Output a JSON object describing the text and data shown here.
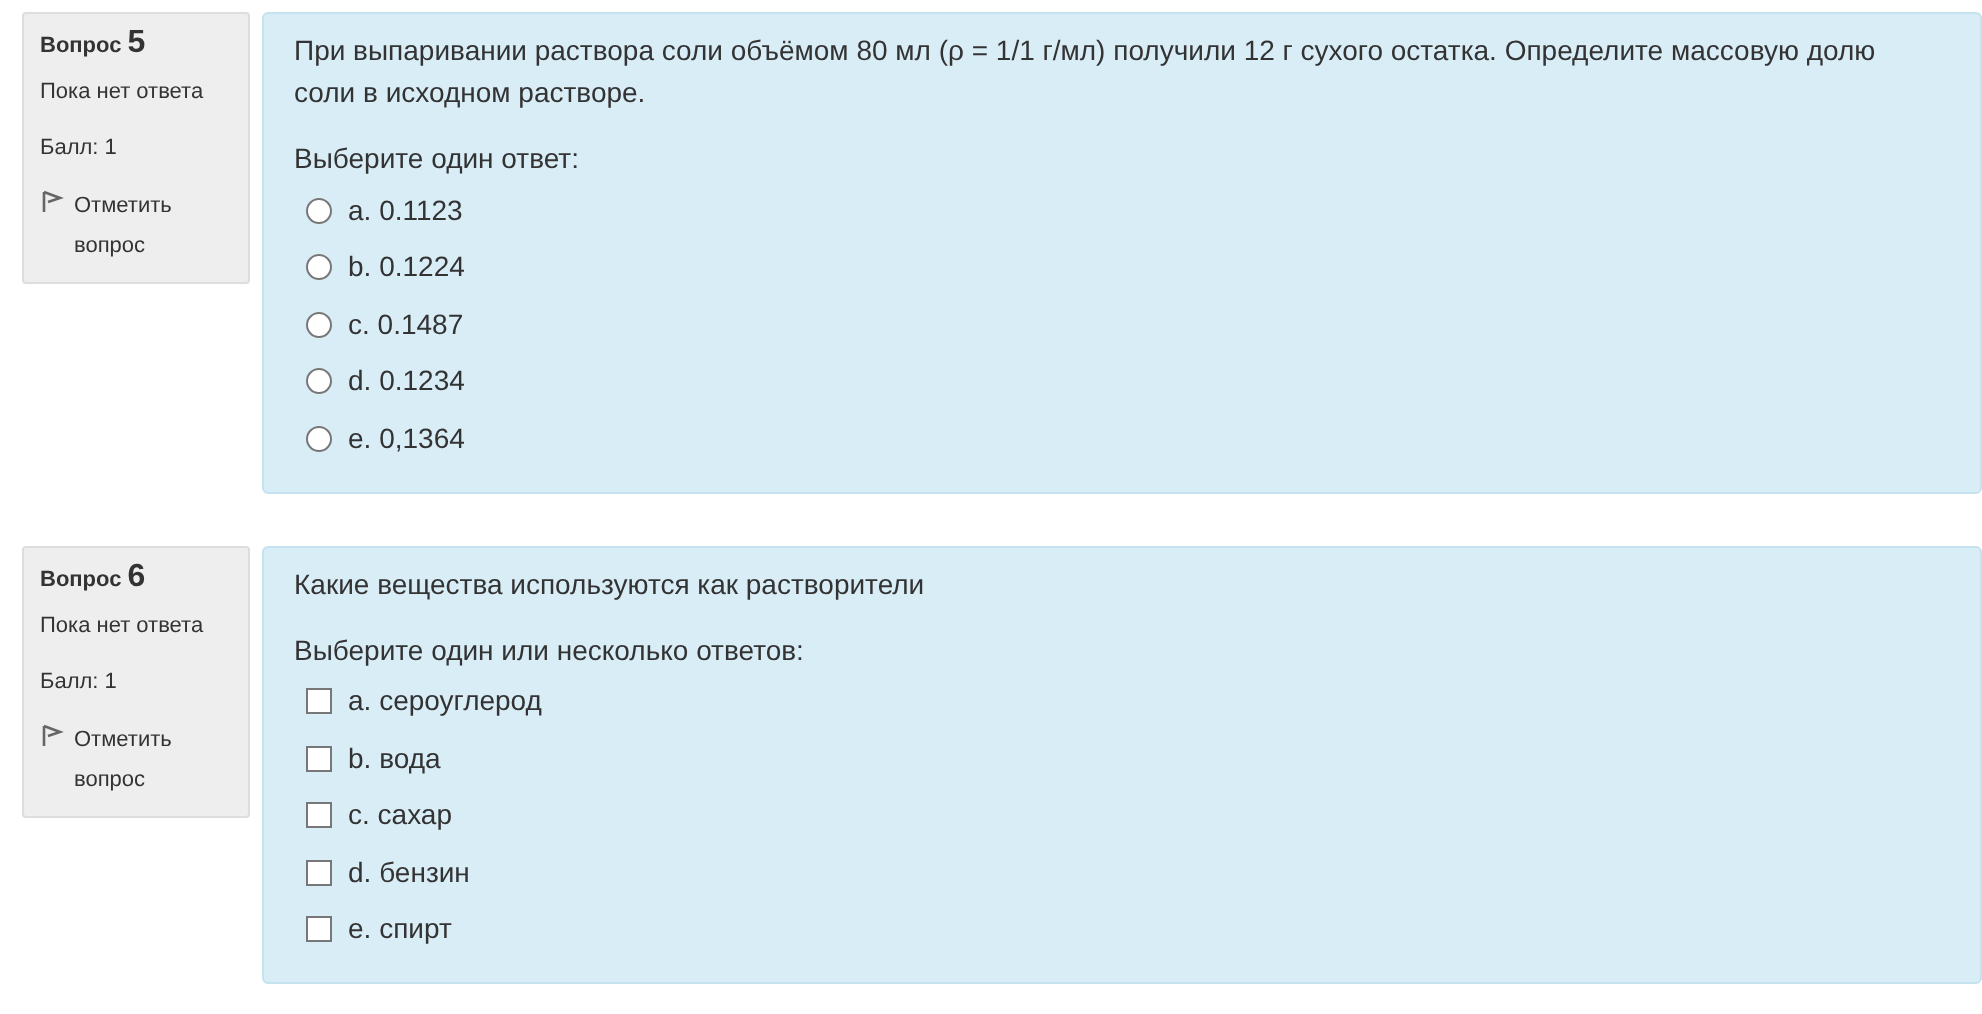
{
  "questions": [
    {
      "label": "Вопрос",
      "number": "5",
      "status": "Пока нет ответа",
      "grade": "Балл: 1",
      "flag": "Отметить вопрос",
      "text": "При выпаривании раствора соли объёмом 80 мл (ρ = 1/1 г/мл) получили 12 г сухого остатка. Определите массовую долю соли в исходном растворе.",
      "prompt": "Выберите один ответ:",
      "kind": "radio",
      "options": [
        {
          "label": "a. 0.1123",
          "checked": false
        },
        {
          "label": "b. 0.1224",
          "checked": false
        },
        {
          "label": "c. 0.1487",
          "checked": false
        },
        {
          "label": "d. 0.1234",
          "checked": false
        },
        {
          "label": "e. 0,1364",
          "checked": false
        }
      ]
    },
    {
      "label": "Вопрос",
      "number": "6",
      "status": "Пока нет ответа",
      "grade": "Балл: 1",
      "flag": "Отметить вопрос",
      "text": "Какие вещества используются как растворители",
      "prompt": "Выберите один или несколько ответов:",
      "kind": "checkbox",
      "options": [
        {
          "label": "a. сероуглерод",
          "checked": false
        },
        {
          "label": "b. вода",
          "checked": false
        },
        {
          "label": "c. сахар",
          "checked": false
        },
        {
          "label": "d. бензин",
          "checked": false
        },
        {
          "label": "e. спирт",
          "checked": false
        }
      ]
    }
  ]
}
